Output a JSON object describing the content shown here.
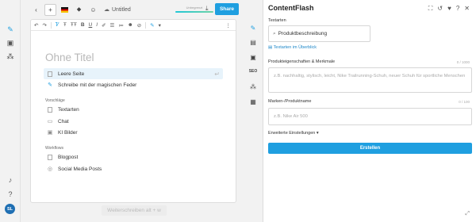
{
  "colors": {
    "accent": "#1f9fe0",
    "brand_green": "#5fb432",
    "active_row": "#e7f3fb"
  },
  "rail": {
    "icons": [
      "logo-icon",
      "magic-pen-icon",
      "image-icon",
      "workflow-icon",
      "bell-icon",
      "help-icon"
    ],
    "avatar": "SL"
  },
  "topbar": {
    "doc_title": "Untitled",
    "status_label": "Unbegrenzt",
    "share_label": "Share"
  },
  "editor": {
    "title_placeholder": "Ohne Titel",
    "blank_page": "Leere Seite",
    "magic_pen": "Schreibe mit der magischen Feder",
    "suggestions_heading": "Vorschläge",
    "suggestions": [
      "Textarten",
      "Chat",
      "KI Bilder"
    ],
    "workflows_heading": "Workflows",
    "workflows": [
      "Blogpost",
      "Social Media Posts"
    ],
    "continue_label": "Weiterschreiben",
    "continue_shortcut": "alt + w"
  },
  "panel": {
    "title": "ContentFlash",
    "textarten_label": "Textarten",
    "textart_value": "Produktbeschreibung",
    "overview_link": "Textarten im Überblick",
    "properties_label": "Produkteigenschaften & Merkmale",
    "properties_count": "0 / 1000",
    "properties_placeholder": "z.B. nachhaltig, stylisch, leicht, Nike Trailrunning-Schuh, neuer Schuh für sportliche Menschen",
    "brand_label": "Marken-/Produktname",
    "brand_count": "0 / 100",
    "brand_placeholder": "z.B. Nike Air 500",
    "advanced_label": "Erweiterte Einstellungen",
    "create_label": "Erstellen"
  }
}
